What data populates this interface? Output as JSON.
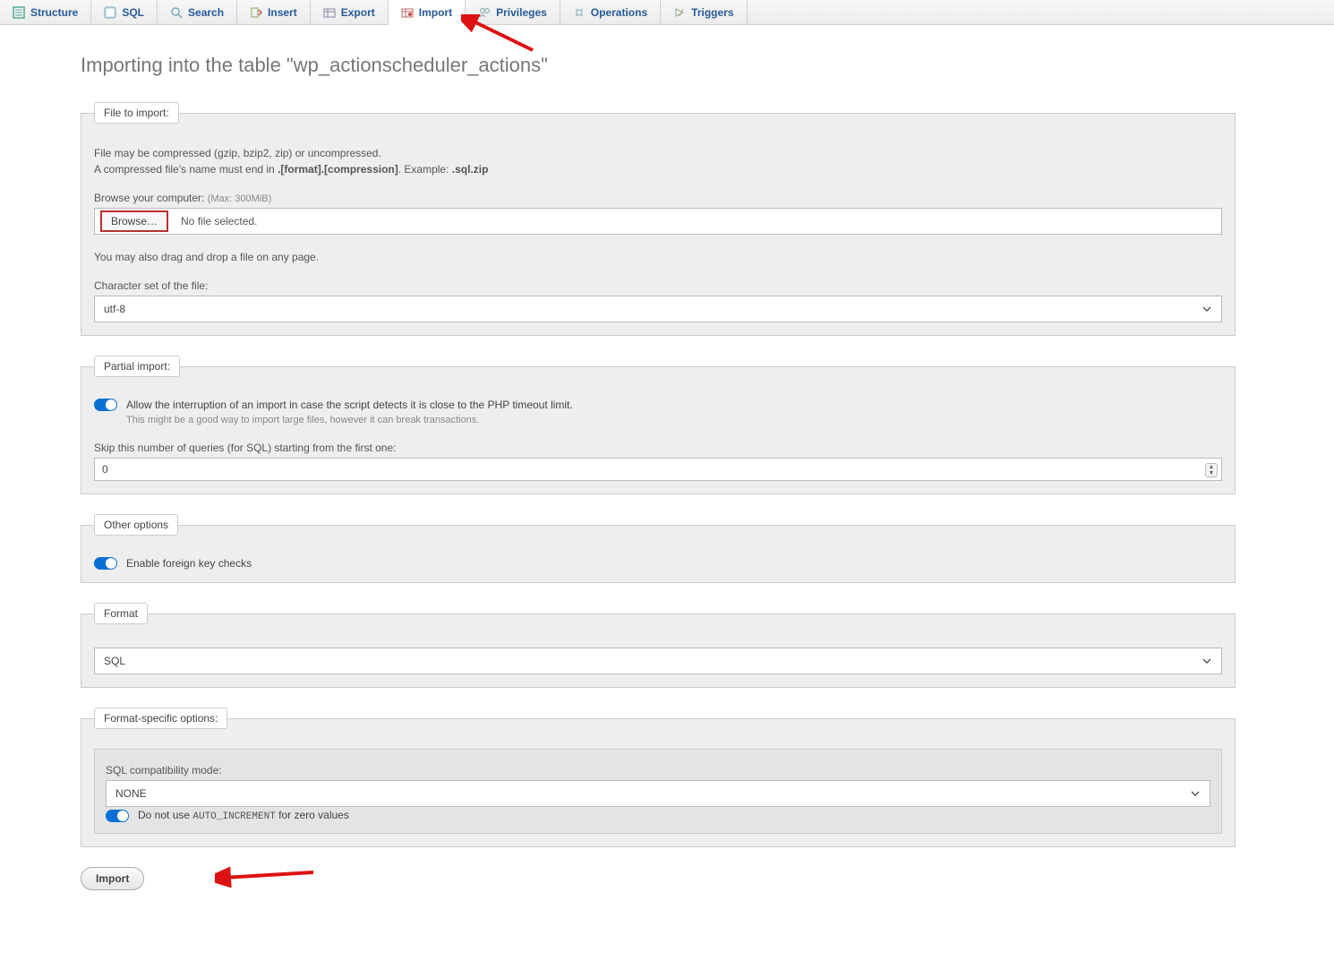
{
  "tabs": {
    "structure": "Structure",
    "sql": "SQL",
    "search": "Search",
    "insert": "Insert",
    "export": "Export",
    "import": "Import",
    "privileges": "Privileges",
    "operations": "Operations",
    "triggers": "Triggers"
  },
  "title": "Importing into the table \"wp_actionscheduler_actions\"",
  "file": {
    "legend": "File to import:",
    "p1": "File may be compressed (gzip, bzip2, zip) or uncompressed.",
    "p2a": "A compressed file's name must end in ",
    "p2b": ".[format].[compression]",
    "p2c": ". Example: ",
    "p2d": ".sql.zip",
    "browse_label": "Browse your computer: ",
    "browse_max": "(Max: 300MiB)",
    "browse_btn": "Browse…",
    "no_file": "No file selected.",
    "drag_note": "You may also drag and drop a file on any page.",
    "charset_label": "Character set of the file:",
    "charset_value": "utf-8"
  },
  "partial": {
    "legend": "Partial import:",
    "allow_label": "Allow the interruption of an import in case the script detects it is close to the PHP timeout limit.",
    "allow_hint": "This might be a good way to import large files, however it can break transactions.",
    "skip_label": "Skip this number of queries (for SQL) starting from the first one:",
    "skip_value": "0"
  },
  "other": {
    "legend": "Other options",
    "fk_label": "Enable foreign key checks"
  },
  "format": {
    "legend": "Format",
    "value": "SQL"
  },
  "fso": {
    "legend": "Format-specific options:",
    "compat_label": "SQL compatibility mode:",
    "compat_value": "NONE",
    "ai_a": "Do not use ",
    "ai_code": "AUTO_INCREMENT",
    "ai_b": " for zero values"
  },
  "import_btn": "Import"
}
